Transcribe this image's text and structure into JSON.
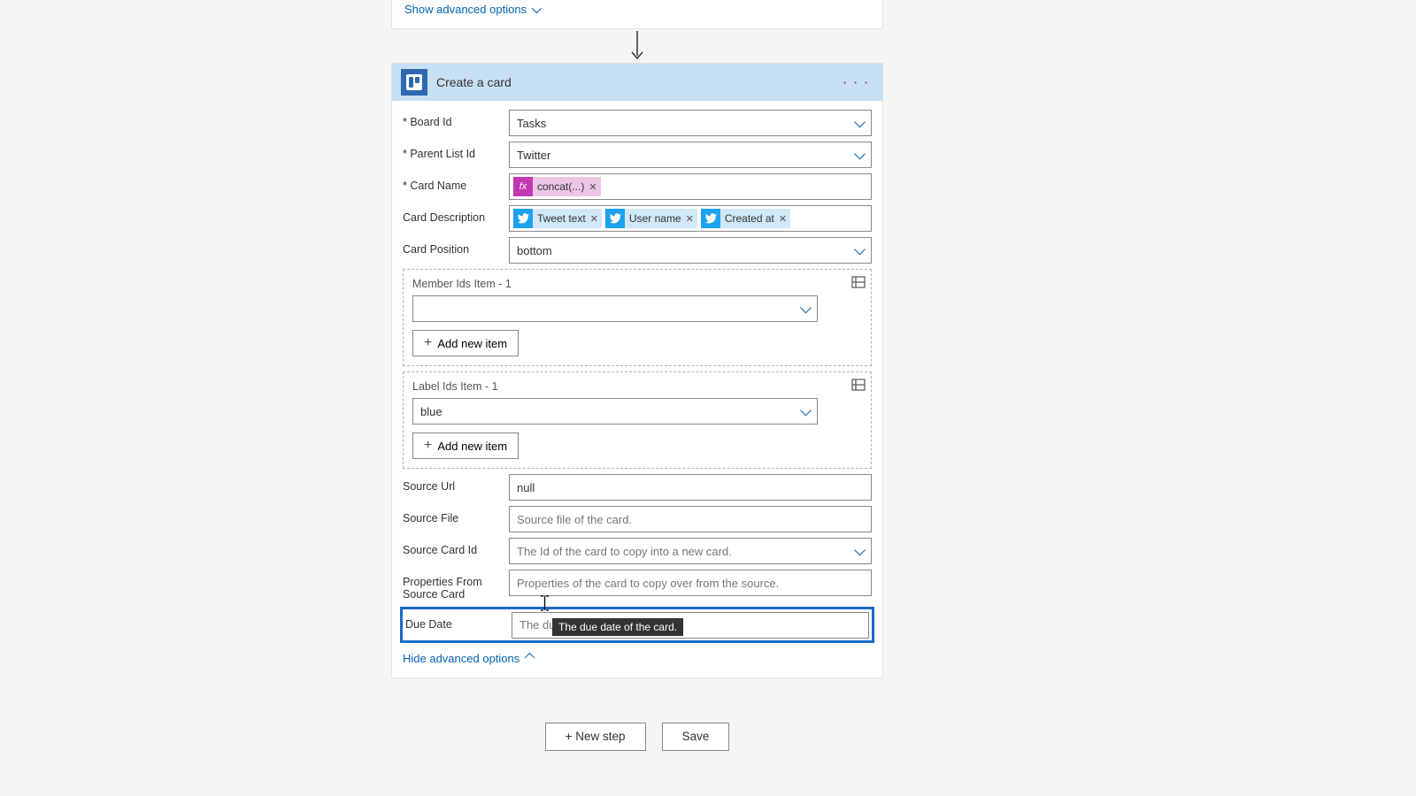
{
  "topCard": {
    "showAdvanced": "Show advanced options"
  },
  "action": {
    "title": "Create a card",
    "menu": "· · ·"
  },
  "fields": {
    "boardId": {
      "label": "Board Id",
      "value": "Tasks"
    },
    "parentListId": {
      "label": "Parent List Id",
      "value": "Twitter"
    },
    "cardName": {
      "label": "Card Name"
    },
    "cardDescription": {
      "label": "Card Description"
    },
    "cardPosition": {
      "label": "Card Position",
      "value": "bottom"
    },
    "memberIds": {
      "label": "Member Ids Item - 1",
      "addBtn": "Add new item"
    },
    "labelIds": {
      "label": "Label Ids Item - 1",
      "value": "blue",
      "addBtn": "Add new item"
    },
    "sourceUrl": {
      "label": "Source Url",
      "value": "null"
    },
    "sourceFile": {
      "label": "Source File",
      "placeholder": "Source file of the card."
    },
    "sourceCardId": {
      "label": "Source Card Id",
      "placeholder": "The Id of the card to copy into a new card."
    },
    "propsFromSource": {
      "label": "Properties From Source Card",
      "placeholder": "Properties of the card to copy over from the source."
    },
    "dueDate": {
      "label": "Due Date",
      "placeholder": "The due date of the card."
    }
  },
  "tokens": {
    "concat": "concat(...)",
    "tweetText": "Tweet text",
    "userName": "User name",
    "createdAt": "Created at"
  },
  "hideAdvanced": "Hide advanced options",
  "tooltip": "The due date of the card.",
  "footer": {
    "newStep": "+ New step",
    "save": "Save"
  }
}
